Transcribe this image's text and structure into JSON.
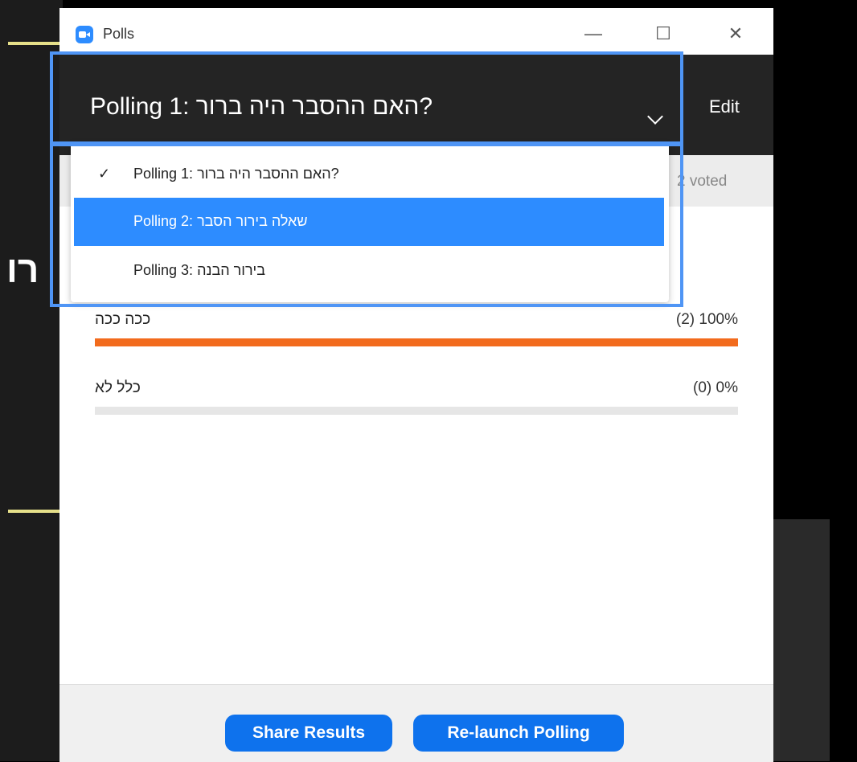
{
  "background": {
    "hebrew_fragment": "רו"
  },
  "window": {
    "title": "Polls",
    "app_icon": "zoom-camera-icon",
    "minimize_glyph": "—",
    "maximize_glyph": "☐",
    "close_glyph": "✕"
  },
  "header": {
    "poll_title": "Polling 1: האם ההסבר היה ברור?",
    "edit_label": "Edit"
  },
  "summary": {
    "voted_text": "2 voted"
  },
  "answers": [
    {
      "label": "ככה ככה",
      "value_text": "(2) 100%",
      "percent": 100
    },
    {
      "label": "כלל לא",
      "value_text": "(0) 0%",
      "percent": 0
    }
  ],
  "dropdown": {
    "check_glyph": "✓",
    "items": [
      {
        "label": "Polling 1: האם ההסבר היה ברור?",
        "checked": true,
        "highlighted": false
      },
      {
        "label": "Polling 2: שאלה בירור הסבר",
        "checked": false,
        "highlighted": true
      },
      {
        "label": "Polling 3: בירור הבנה",
        "checked": false,
        "highlighted": false
      }
    ]
  },
  "footer": {
    "share_results_label": "Share Results",
    "relaunch_label": "Re-launch Polling"
  },
  "colors": {
    "accent_blue": "#0e72ed",
    "selection_blue": "#2d8cff",
    "bar_orange": "#f26b1d",
    "highlight_outline": "#4f95f5"
  }
}
